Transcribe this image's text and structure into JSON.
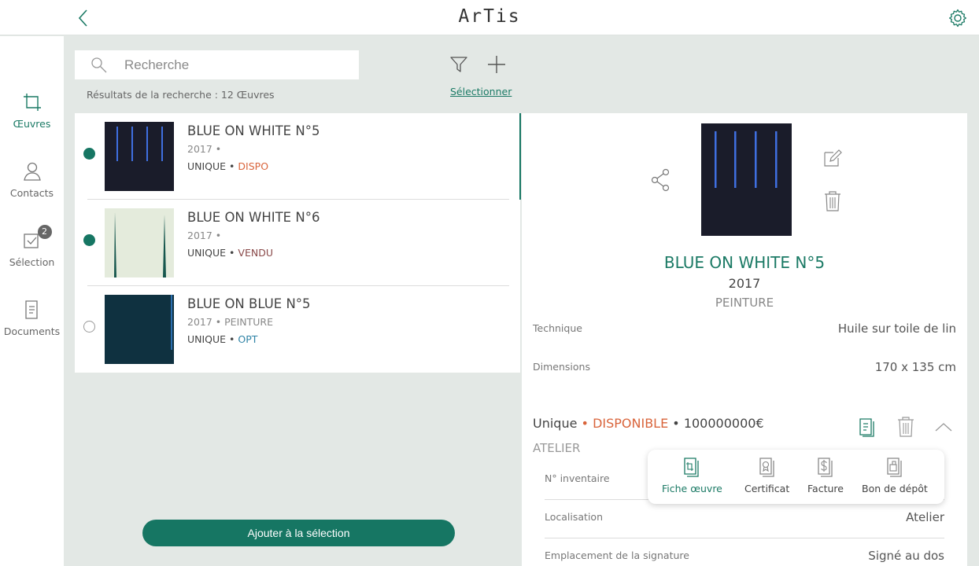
{
  "header": {
    "logo": "ArTis"
  },
  "nav": {
    "items": [
      {
        "label": "Œuvres",
        "active": true
      },
      {
        "label": "Contacts",
        "active": false
      },
      {
        "label": "Sélection",
        "active": false,
        "badge": "2"
      },
      {
        "label": "Documents",
        "active": false
      }
    ]
  },
  "search": {
    "placeholder": "Recherche",
    "results_label": "Résultats de la recherche : 12 Œuvres",
    "select_label": "Sélectionner"
  },
  "list": {
    "rows": [
      {
        "title": "BLUE ON WHITE N°5",
        "sub": "2017 •",
        "edition": "UNIQUE •",
        "status": "DISPO",
        "status_color": "#d9643b",
        "selected": true
      },
      {
        "title": "BLUE ON WHITE N°6",
        "sub": "2017 •",
        "edition": "UNIQUE •",
        "status": "VENDU",
        "status_color": "#8a4a4a",
        "selected": true
      },
      {
        "title": "BLUE ON BLUE N°5",
        "sub": "2017 • PEINTURE",
        "edition": "UNIQUE •",
        "status": "OPT",
        "status_color": "#2f83a6",
        "selected": false
      }
    ]
  },
  "add_button": "Ajouter à la sélection",
  "detail": {
    "title": "BLUE ON WHITE N°5",
    "year": "2017",
    "type": "PEINTURE",
    "technique_label": "Technique",
    "technique_value": "Huile sur toile de lin",
    "dimensions_label": "Dimensions",
    "dimensions_value": "170 x 135 cm",
    "edition": "Unique",
    "availability": "DISPONIBLE",
    "price": "100000000€",
    "location_group": "ATELIER",
    "inventory_label": "N° inventaire",
    "localisation_label": "Localisation",
    "localisation_value": "Atelier",
    "signature_label": "Emplacement de la signature",
    "signature_value": "Signé au dos"
  },
  "popup": {
    "items": [
      {
        "label": "Fiche œuvre",
        "active": true
      },
      {
        "label": "Certificat",
        "active": false
      },
      {
        "label": "Facture",
        "active": false
      },
      {
        "label": "Bon de dépôt",
        "active": false
      }
    ]
  },
  "colors": {
    "accent": "#167663",
    "dispo": "#d9643b",
    "vendu": "#8a4a4a",
    "opt": "#2f83a6"
  }
}
